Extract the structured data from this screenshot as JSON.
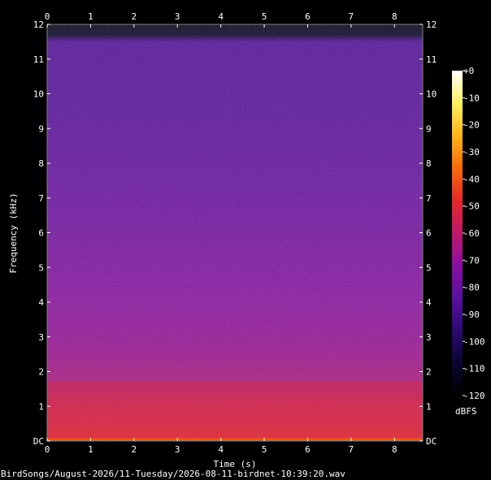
{
  "chart_data": {
    "type": "heatmap",
    "title": "",
    "xlabel": "Time (s)",
    "ylabel": "Frequency (kHz)",
    "xlim": [
      0,
      8.65
    ],
    "ylim": [
      0,
      12
    ],
    "x_ticks": [
      {
        "value": 0,
        "label": "0"
      },
      {
        "value": 1,
        "label": "1"
      },
      {
        "value": 2,
        "label": "2"
      },
      {
        "value": 3,
        "label": "3"
      },
      {
        "value": 4,
        "label": "4"
      },
      {
        "value": 5,
        "label": "5"
      },
      {
        "value": 6,
        "label": "6"
      },
      {
        "value": 7,
        "label": "7"
      },
      {
        "value": 8,
        "label": "8"
      }
    ],
    "y_ticks": [
      {
        "value": 0,
        "label": "DC"
      },
      {
        "value": 1,
        "label": "1"
      },
      {
        "value": 2,
        "label": "2"
      },
      {
        "value": 3,
        "label": "3"
      },
      {
        "value": 4,
        "label": "4"
      },
      {
        "value": 5,
        "label": "5"
      },
      {
        "value": 6,
        "label": "6"
      },
      {
        "value": 7,
        "label": "7"
      },
      {
        "value": 8,
        "label": "8"
      },
      {
        "value": 9,
        "label": "9"
      },
      {
        "value": 10,
        "label": "10"
      },
      {
        "value": 11,
        "label": "11"
      },
      {
        "value": 12,
        "label": "12"
      }
    ],
    "colorbar": {
      "unit_label": "dBFS",
      "range": [
        -120,
        0
      ],
      "ticks": [
        {
          "value": 0,
          "label": "+0"
        },
        {
          "value": -10,
          "label": "-10"
        },
        {
          "value": -20,
          "label": "-20"
        },
        {
          "value": -30,
          "label": "-30"
        },
        {
          "value": -40,
          "label": "-40"
        },
        {
          "value": -50,
          "label": "-50"
        },
        {
          "value": -60,
          "label": "-60"
        },
        {
          "value": -70,
          "label": "-70"
        },
        {
          "value": -80,
          "label": "-80"
        },
        {
          "value": -90,
          "label": "-90"
        },
        {
          "value": -100,
          "label": "-100"
        },
        {
          "value": -110,
          "label": "-110"
        },
        {
          "value": -120,
          "label": "-120"
        }
      ],
      "colors": [
        "#000000",
        "#0a0530",
        "#2a0a70",
        "#5a10a0",
        "#8a10a0",
        "#c0186a",
        "#e8282a",
        "#f86a0a",
        "#ffb41a",
        "#fff060",
        "#ffffff"
      ]
    },
    "intensity_profile_db": [
      {
        "freq_khz": 0.0,
        "db": -50
      },
      {
        "freq_khz": 0.5,
        "db": -55
      },
      {
        "freq_khz": 1.0,
        "db": -58
      },
      {
        "freq_khz": 1.5,
        "db": -63
      },
      {
        "freq_khz": 2.0,
        "db": -66
      },
      {
        "freq_khz": 3.0,
        "db": -70
      },
      {
        "freq_khz": 4.0,
        "db": -72
      },
      {
        "freq_khz": 5.0,
        "db": -75
      },
      {
        "freq_khz": 6.0,
        "db": -78
      },
      {
        "freq_khz": 8.0,
        "db": -82
      },
      {
        "freq_khz": 10.0,
        "db": -85
      },
      {
        "freq_khz": 11.5,
        "db": -86
      },
      {
        "freq_khz": 11.7,
        "db": -110
      },
      {
        "freq_khz": 12.0,
        "db": -115
      }
    ],
    "grid": false
  },
  "footer": {
    "file_path": "BirdSongs/August-2026/11-Tuesday/2026-08-11-birdnet-10:39:20.wav"
  }
}
